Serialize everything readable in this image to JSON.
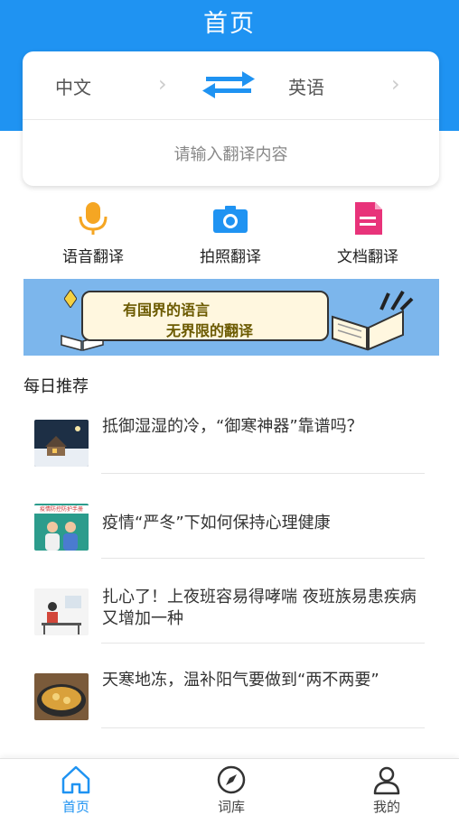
{
  "header": {
    "title": "首页"
  },
  "translator": {
    "source_lang": "中文",
    "target_lang": "英语",
    "input_placeholder": "请输入翻译内容"
  },
  "tools": [
    {
      "label": "语音翻译",
      "icon": "microphone-icon"
    },
    {
      "label": "拍照翻译",
      "icon": "camera-icon"
    },
    {
      "label": "文档翻译",
      "icon": "document-icon"
    }
  ],
  "banner": {
    "line1": "有国界的语言",
    "line2": "无界限的翻译"
  },
  "daily": {
    "title": "每日推荐",
    "items": [
      {
        "title": "抵御湿湿的冷，“御寒神器”靠谱吗？"
      },
      {
        "title": "疫情“严冬”下如何保持心理健康",
        "thumb_text": "疫情防控防护手册"
      },
      {
        "title": "扎心了！上夜班容易得哮喘 夜班族易患疾病又增加一种"
      },
      {
        "title": "天寒地冻，温补阳气要做到“两不两要”"
      }
    ]
  },
  "tabbar": [
    {
      "label": "首页",
      "icon": "home-icon",
      "active": true
    },
    {
      "label": "词库",
      "icon": "compass-icon",
      "active": false
    },
    {
      "label": "我的",
      "icon": "user-icon",
      "active": false
    }
  ],
  "colors": {
    "primary": "#1f93f2",
    "mic": "#f5a623",
    "doc": "#e8337a",
    "banner": "#7cb6ec"
  }
}
